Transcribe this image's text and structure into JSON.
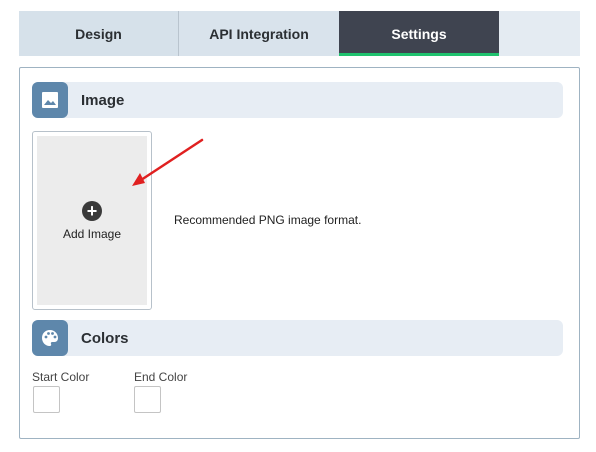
{
  "tabs": [
    {
      "label": "Design",
      "active": false
    },
    {
      "label": "API Integration",
      "active": false
    },
    {
      "label": "Settings",
      "active": true
    }
  ],
  "colors": {
    "active_tab_bg": "#3f4450",
    "active_tab_indicator": "#1fc26e",
    "section_icon_bg": "#5e87ab",
    "arrow": "#e02020"
  },
  "image_section": {
    "title": "Image",
    "icon": "image-icon",
    "add_label": "Add Image",
    "hint": "Recommended PNG image format."
  },
  "colors_section": {
    "title": "Colors",
    "icon": "palette-icon",
    "start_label": "Start Color",
    "end_label": "End Color",
    "start_value": "#ffffff",
    "end_value": "#ffffff"
  }
}
